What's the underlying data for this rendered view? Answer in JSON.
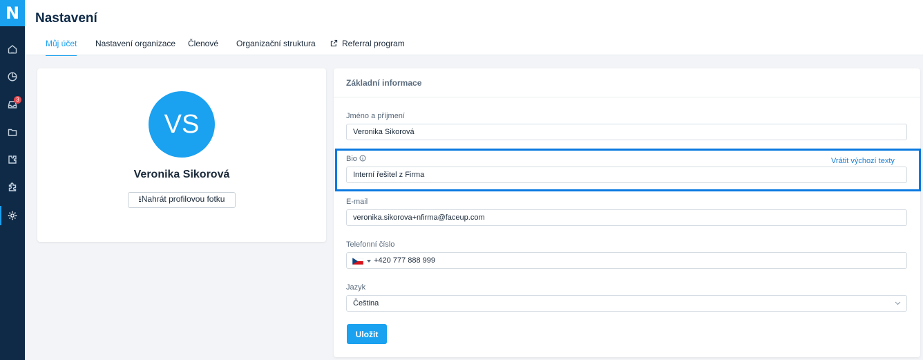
{
  "app": {
    "logo_letter": "N",
    "accent_color": "#1aa1f0",
    "sidebar_color": "#0e2a47"
  },
  "sidebar": {
    "items": [
      {
        "icon": "home-icon"
      },
      {
        "icon": "pie-chart-icon"
      },
      {
        "icon": "inbox-icon",
        "badge": "3"
      },
      {
        "icon": "folder-icon"
      },
      {
        "icon": "puzzle-gear-icon"
      },
      {
        "icon": "puzzle-icon"
      },
      {
        "icon": "gear-icon",
        "active": true
      }
    ]
  },
  "header": {
    "title": "Nastavení",
    "tabs": [
      {
        "label": "Můj účet",
        "active": true
      },
      {
        "label": "Nastavení organizace"
      },
      {
        "label": "Členové"
      },
      {
        "label": "Organizační struktura"
      },
      {
        "label": "Referral program",
        "icon": "external-link-icon"
      }
    ]
  },
  "profile": {
    "initials": "VS",
    "name": "Veronika Sikorová",
    "upload_label": "⭳Nahrát profilovou fotku"
  },
  "form": {
    "title": "Základní informace",
    "name_label": "Jméno a příjmení",
    "name_value": "Veronika Sikorová",
    "bio_label": "Bio",
    "bio_reset_label": "Vrátit výchozí texty",
    "bio_value": "Interní řešitel z Firma",
    "email_label": "E-mail",
    "email_value": "veronika.sikorova+nfirma@faceup.com",
    "phone_label": "Telefonní číslo",
    "phone_value": "+420 777 888 999",
    "language_label": "Jazyk",
    "language_value": "Čeština",
    "save_label": "Uložit"
  }
}
